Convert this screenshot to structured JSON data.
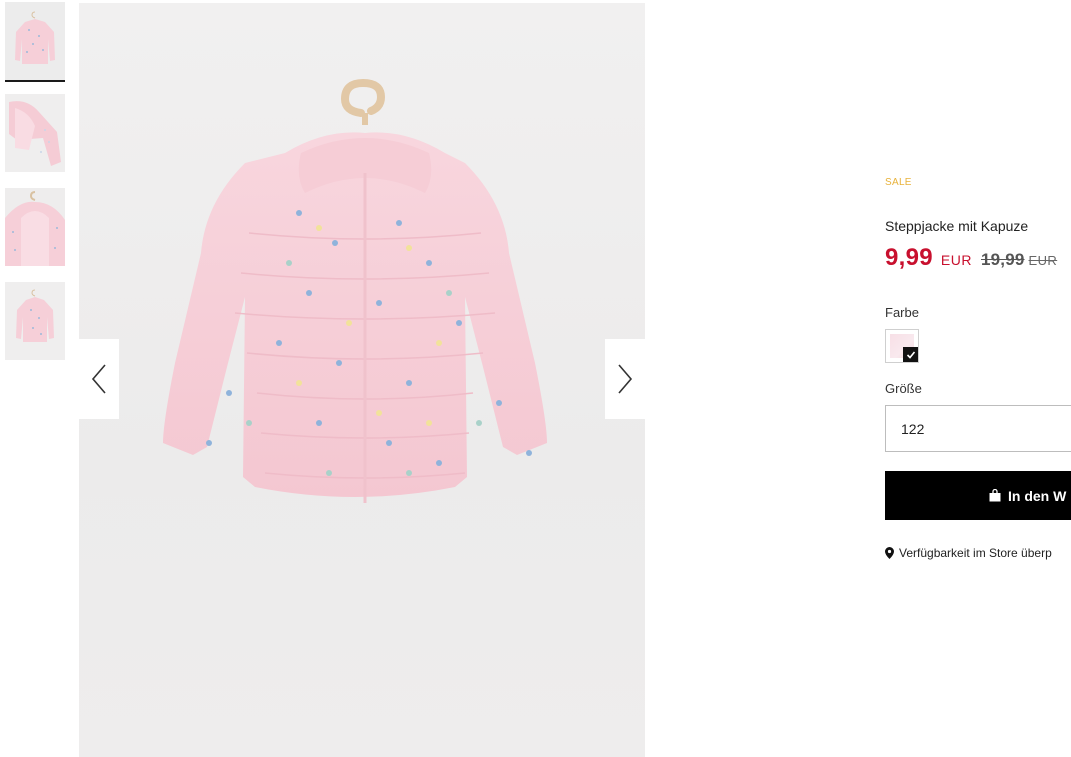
{
  "gallery": {
    "thumbnails": [
      {
        "alt": "thumbnail-front",
        "active": true
      },
      {
        "alt": "thumbnail-inside",
        "active": false
      },
      {
        "alt": "thumbnail-hood-detail",
        "active": false
      },
      {
        "alt": "thumbnail-back",
        "active": false
      }
    ],
    "prev_icon": "chevron-left-icon",
    "next_icon": "chevron-right-icon"
  },
  "product": {
    "badge": "SALE",
    "title": "Steppjacke mit Kapuze",
    "price": {
      "current": "9,99",
      "current_currency": "EUR",
      "old": "19,99",
      "old_currency": "EUR"
    },
    "color_label": "Farbe",
    "size_label": "Größe",
    "size_value": "122",
    "cart_button": "In den W",
    "store_link": "Verfügbarkeit im Store überp"
  },
  "colors": {
    "sale": "#e8b23a",
    "price": "#c8102e",
    "button_bg": "#000000",
    "jacket": "#f7d3dc"
  }
}
